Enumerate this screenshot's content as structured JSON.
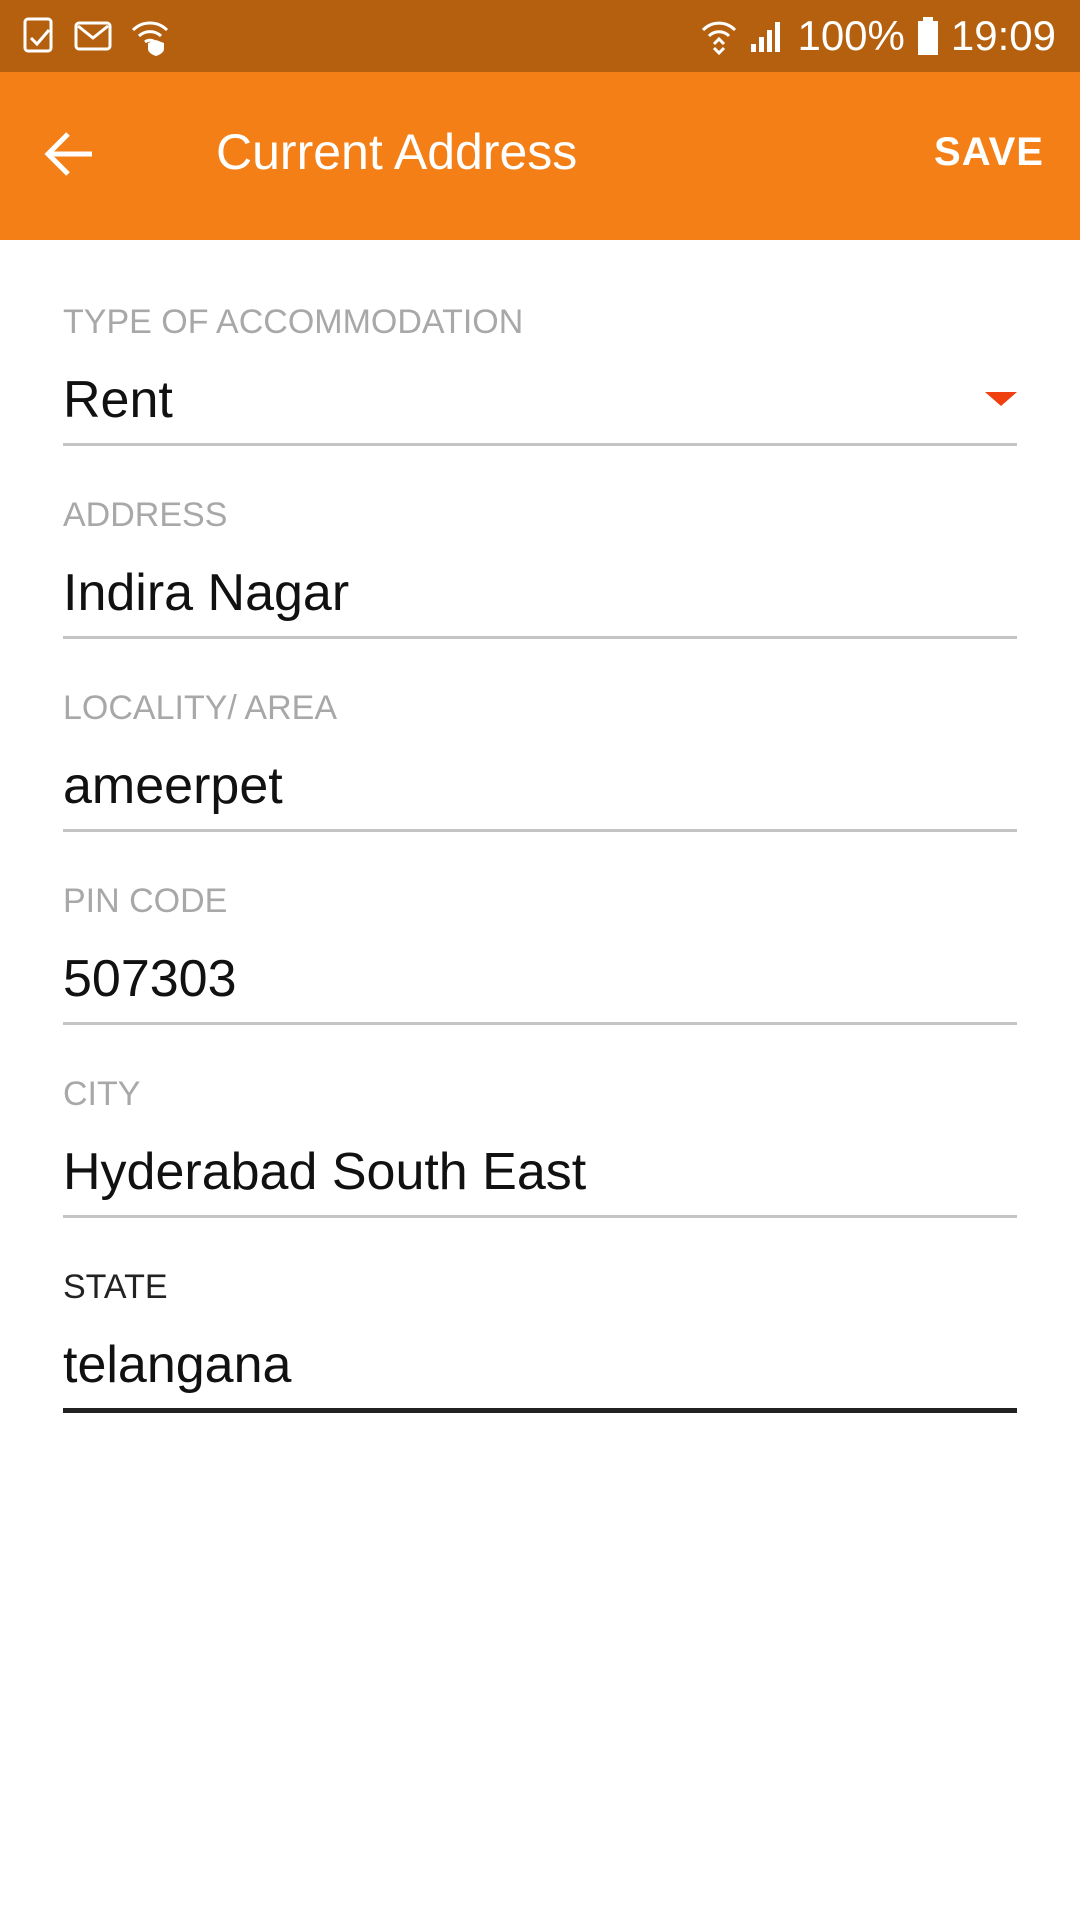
{
  "status_bar": {
    "icons_left": [
      "phone-check-icon",
      "gmail-icon",
      "wifi-shield-icon"
    ],
    "icons_right": [
      "wifi-arrows-icon",
      "signal-icon",
      "battery-icon"
    ],
    "battery": "100%",
    "time": "19:09"
  },
  "app_bar": {
    "back_icon": "arrow-left-icon",
    "title": "Current Address",
    "save_label": "SAVE",
    "color": "#F47F16"
  },
  "form": {
    "fields": [
      {
        "label": "TYPE OF ACCOMMODATION",
        "value": "Rent",
        "type": "dropdown"
      },
      {
        "label": "ADDRESS",
        "value": "Indira Nagar",
        "type": "text"
      },
      {
        "label": "LOCALITY/ AREA",
        "value": "ameerpet",
        "type": "text"
      },
      {
        "label": "PIN CODE",
        "value": "507303",
        "type": "text"
      },
      {
        "label": "CITY",
        "value": "Hyderabad South East",
        "type": "text"
      },
      {
        "label": "STATE",
        "value": "telangana",
        "type": "text",
        "focused": true
      }
    ]
  },
  "colors": {
    "status_bar": "#B5600F",
    "accent": "#F47F16",
    "dropdown_arrow": "#F0400F"
  }
}
